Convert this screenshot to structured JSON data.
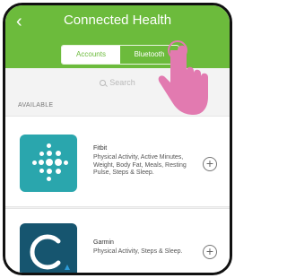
{
  "header": {
    "back_glyph": "‹",
    "title": "Connected Health"
  },
  "segments": [
    {
      "label": "Accounts",
      "active": true
    },
    {
      "label": "Bluetooth",
      "active": false
    }
  ],
  "search": {
    "placeholder": "Search"
  },
  "section_title": "AVAILABLE",
  "apps": [
    {
      "name": "Fitbit",
      "description": "Physical Activity, Active Minutes, Weight, Body Fat, Meals, Resting Pulse, Steps & Sleep.",
      "icon": "fitbit-logo"
    },
    {
      "name": "Garmin",
      "description": "Physical Activity, Steps & Sleep.",
      "icon": "garmin-connect-logo"
    }
  ],
  "add_glyph": "+",
  "colors": {
    "header": "#6cbb3c",
    "fitbit_icon": "#2aa6ad",
    "garmin_icon": "#16556f",
    "pointer_hand": "#e27ab0"
  }
}
